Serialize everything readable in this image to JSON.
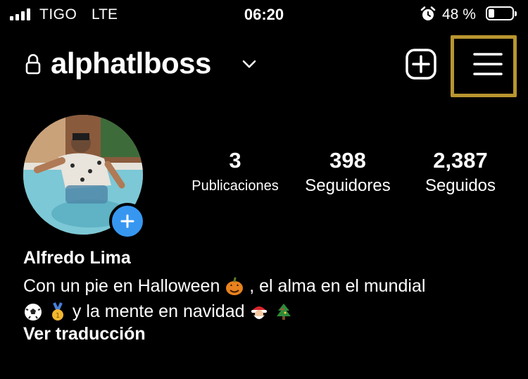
{
  "status_bar": {
    "carrier": "TIGO",
    "network": "LTE",
    "time": "06:20",
    "battery_percent": "48 %",
    "battery_level": 0.2
  },
  "header": {
    "username": "alphatlboss",
    "icons": [
      "lock-icon",
      "chevron-down-icon",
      "create-plus-icon",
      "hamburger-menu-icon"
    ],
    "highlight_color": "#b8952f"
  },
  "profile": {
    "stats": [
      {
        "value": "3",
        "label": "Publicaciones"
      },
      {
        "value": "398",
        "label": "Seguidores"
      },
      {
        "value": "2,387",
        "label": "Seguidos"
      }
    ],
    "full_name": "Alfredo Lima",
    "bio_line1_a": "Con un pie en Halloween",
    "bio_line1_b": ", el alma en el mundial",
    "bio_line2": "y la mente en navidad",
    "translate_label": "Ver traducción",
    "add_story_color": "#3797f0"
  }
}
